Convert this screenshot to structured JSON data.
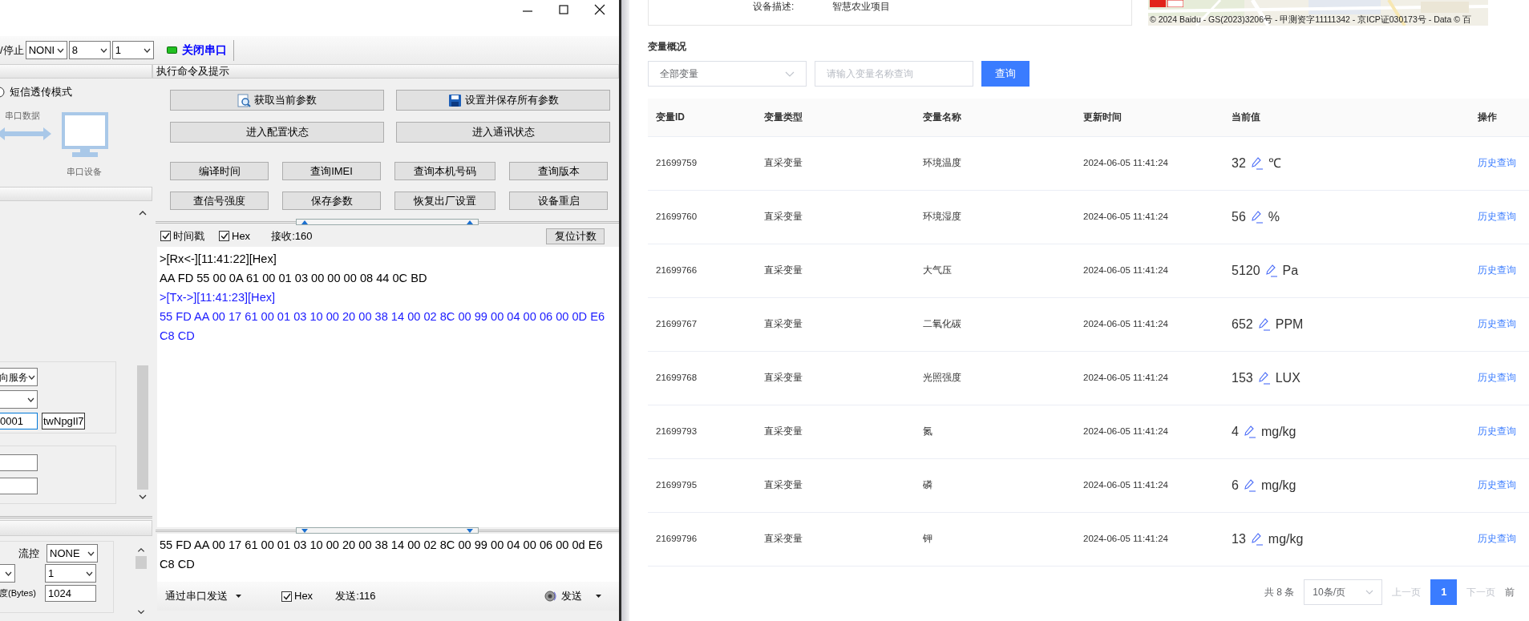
{
  "serial_tool": {
    "toolbar": {
      "stop_label": "/停止",
      "parity": "NONI",
      "data_bits": "8",
      "stop_bits": "1",
      "port_button": {
        "label": "关闭串口",
        "open": true
      }
    },
    "left_panel": {
      "radio": {
        "label": "短信透传模式",
        "selected": false
      },
      "diagram": {
        "data_label": "串口数据",
        "device_label": "串口设备"
      },
      "server_select": "向服务",
      "id_field": {
        "value": "0001",
        "focused": true
      },
      "password_field": {
        "value": "twNpgIl7",
        "focused": false
      },
      "flow_label": "流控",
      "flow_control": "NONE",
      "stop_select": "1",
      "length_label": "度(Bytes)",
      "length_field": "1024"
    },
    "command_panel": {
      "title": "执行命令及提示",
      "wide_buttons": [
        {
          "label": "获取当前参数"
        },
        {
          "label": "设置并保存所有参数"
        },
        {
          "label": "进入配置状态"
        },
        {
          "label": "进入通讯状态"
        }
      ],
      "buttons": [
        "编译时间",
        "查询IMEI",
        "查询本机号码",
        "查询版本",
        "查信号强度",
        "保存参数",
        "恢复出厂设置",
        "设备重启"
      ]
    },
    "receive": {
      "timestamp": {
        "label": "时间戳",
        "checked": true
      },
      "hex": {
        "label": "Hex",
        "checked": true
      },
      "counter": "接收:160",
      "reset_button": "复位计数",
      "lines": [
        {
          "kind": "rx",
          "text": ">[Rx<-][11:41:22][Hex]"
        },
        {
          "kind": "rx",
          "text": "AA FD 55 00 0A 61 00 01 03 00 00 00 08 44 0C BD"
        },
        {
          "kind": "tx",
          "text": ">[Tx->][11:41:23][Hex]"
        },
        {
          "kind": "tx",
          "text": "55 FD AA 00 17 61 00 01 03 10 00 20 00 38 14 00 02 8C 00 99 00 04 00 06 00 0D E6 C8 CD"
        }
      ]
    },
    "send": {
      "text": "55 FD AA 00 17 61 00 01 03 10 00 20 00 38 14 00 02 8C 00 99 00 04 00 06 00 0d E6 C8 CD",
      "mode_button": "通过串口发送",
      "hex": {
        "label": "Hex",
        "checked": true
      },
      "counter": "发送:116",
      "send_button": "发送"
    }
  },
  "device_page": {
    "description_label": "设备描述:",
    "description": "智慧农业项目",
    "map_copyright": "© 2024 Baidu - GS(2023)3206号 - 甲测资字11111342 - 京ICP证030173号 - Data © 百",
    "section_title": "变量概况",
    "filter": {
      "value": "全部变量"
    },
    "search": {
      "placeholder": "请输入变量名称查询"
    },
    "query_button": "查询",
    "table": {
      "columns": [
        "变量ID",
        "变量类型",
        "变量名称",
        "更新时间",
        "当前值",
        "操作"
      ],
      "rows": [
        {
          "id": "21699759",
          "type": "直采变量",
          "name": "环境温度",
          "time": "2024-06-05 11:41:24",
          "value": "32",
          "unit": "℃",
          "action": "历史查询"
        },
        {
          "id": "21699760",
          "type": "直采变量",
          "name": "环境湿度",
          "time": "2024-06-05 11:41:24",
          "value": "56",
          "unit": "%",
          "action": "历史查询"
        },
        {
          "id": "21699766",
          "type": "直采变量",
          "name": "大气压",
          "time": "2024-06-05 11:41:24",
          "value": "5120",
          "unit": "Pa",
          "action": "历史查询"
        },
        {
          "id": "21699767",
          "type": "直采变量",
          "name": "二氧化碳",
          "time": "2024-06-05 11:41:24",
          "value": "652",
          "unit": "PPM",
          "action": "历史查询"
        },
        {
          "id": "21699768",
          "type": "直采变量",
          "name": "光照强度",
          "time": "2024-06-05 11:41:24",
          "value": "153",
          "unit": "LUX",
          "action": "历史查询"
        },
        {
          "id": "21699793",
          "type": "直采变量",
          "name": "氮",
          "time": "2024-06-05 11:41:24",
          "value": "4",
          "unit": "mg/kg",
          "action": "历史查询"
        },
        {
          "id": "21699795",
          "type": "直采变量",
          "name": "磷",
          "time": "2024-06-05 11:41:24",
          "value": "6",
          "unit": "mg/kg",
          "action": "历史查询"
        },
        {
          "id": "21699796",
          "type": "直采变量",
          "name": "钾",
          "time": "2024-06-05 11:41:24",
          "value": "13",
          "unit": "mg/kg",
          "action": "历史查询"
        }
      ]
    },
    "pagination": {
      "total": "共 8 条",
      "page_size": "10条/页",
      "prev": {
        "label": "上一页",
        "disabled": true
      },
      "pages": [
        {
          "label": "1",
          "selected": true
        }
      ],
      "next": {
        "label": "下一页",
        "disabled": true
      },
      "jump": "前"
    }
  }
}
